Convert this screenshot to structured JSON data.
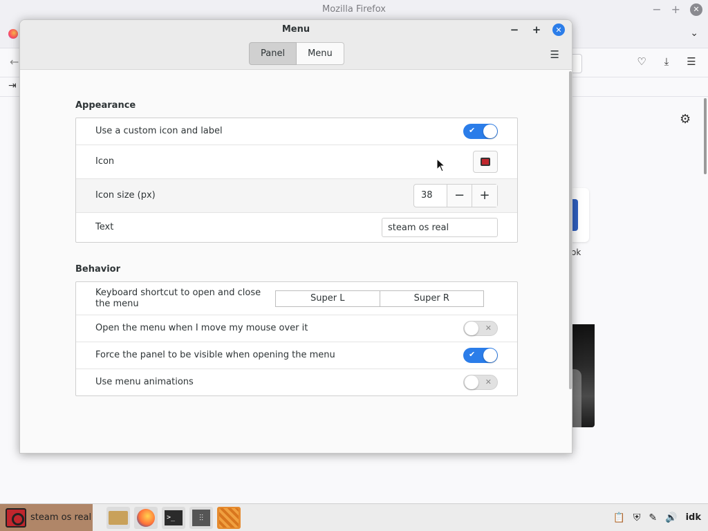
{
  "firefox": {
    "window_title": "Mozilla Firefox",
    "shortcut_label": "ok"
  },
  "dialog": {
    "title": "Menu",
    "tabs": [
      {
        "label": "Panel",
        "active": true
      },
      {
        "label": "Menu",
        "active": false
      }
    ],
    "appearance": {
      "title": "Appearance",
      "custom_icon_label": "Use a custom icon and label",
      "custom_icon_on": true,
      "icon_label": "Icon",
      "icon_size_label": "Icon size (px)",
      "icon_size_value": "38",
      "text_label": "Text",
      "text_value": "steam os real"
    },
    "behavior": {
      "title": "Behavior",
      "shortcut_label": "Keyboard shortcut to open and close the menu",
      "shortcut_keys": [
        "Super L",
        "Super R"
      ],
      "hover_label": "Open the menu when I move my mouse over it",
      "hover_on": false,
      "force_panel_label": "Force the panel to be visible when opening the menu",
      "force_panel_on": true,
      "animations_label": "Use menu animations",
      "animations_on": false
    }
  },
  "taskbar": {
    "menu_label": "steam os real",
    "clock": "idk",
    "launchers": [
      "folder-icon",
      "firefox-icon",
      "terminal-icon",
      "mixer-icon",
      "active-app-icon"
    ],
    "tray_icons": [
      "clipboard-icon",
      "shield-icon",
      "pen-icon",
      "volume-icon"
    ]
  },
  "colors": {
    "accent": "#2b7de9",
    "menu_button": "#b08668",
    "active_launcher": "#e58a2e"
  }
}
